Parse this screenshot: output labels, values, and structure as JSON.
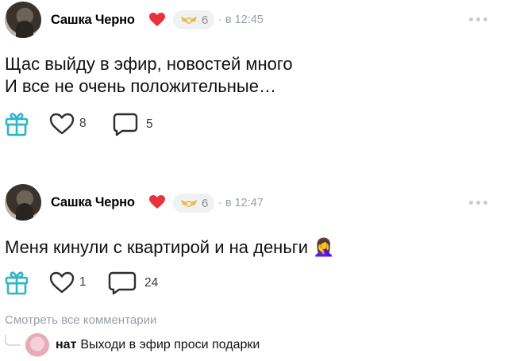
{
  "posts": [
    {
      "author": "Сашка Черно",
      "level": "6",
      "time": "· в 12:45",
      "text_lines": [
        "Щас выйду в эфир, новостей много",
        "И все не очень положительные…"
      ],
      "text_single": "",
      "likes": "8",
      "comments": "5"
    },
    {
      "author": "Сашка Черно",
      "level": "6",
      "time": "· в 12:47",
      "text_lines": [
        "Меня кинули с квартирой и на деньги 🤦‍♀️"
      ],
      "likes": "1",
      "comments": "24"
    }
  ],
  "see_all_comments": "Смотреть все комментарии",
  "preview_comment": {
    "author": "нат",
    "text": "Выходи в эфир проси подарки"
  },
  "colors": {
    "accent_teal": "#2bb5c8",
    "heart_red": "#e8323c",
    "badge_gold": "#e9b949",
    "muted_text": "#9aa0a8"
  }
}
